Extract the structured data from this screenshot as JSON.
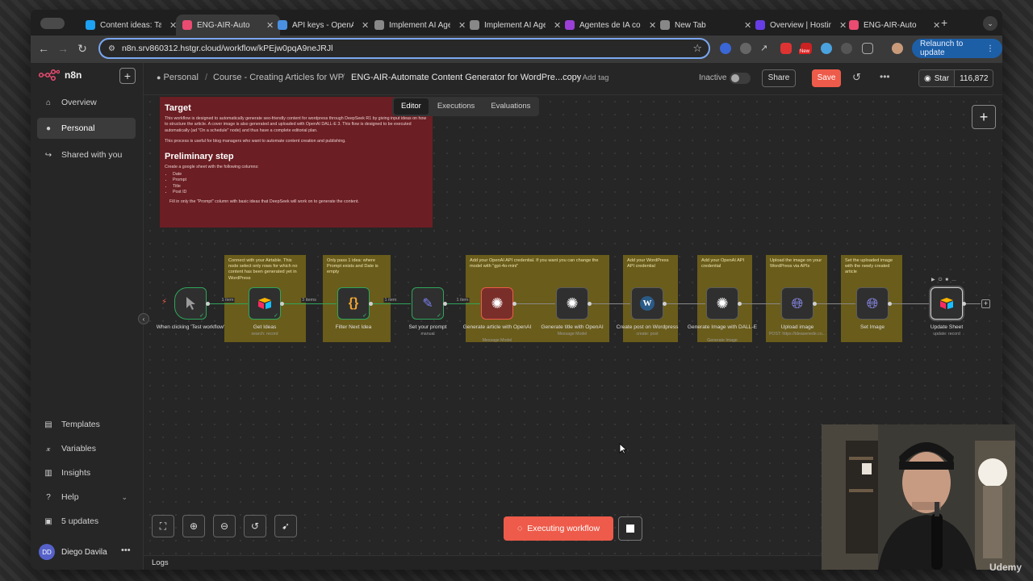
{
  "browser": {
    "tabs": [
      {
        "title": "Content ideas: Ta",
        "color": "#1da1f2"
      },
      {
        "title": "ENG-AIR-Auto",
        "color": "#ea4b71"
      },
      {
        "title": "API keys - OpenA",
        "color": "#4a90e2"
      },
      {
        "title": "Implement AI Age",
        "color": "#888888"
      },
      {
        "title": "Implement AI Age",
        "color": "#888888"
      },
      {
        "title": "Agentes de IA co",
        "color": "#9b3fd6"
      },
      {
        "title": "New Tab",
        "color": "#888888"
      },
      {
        "title": "Overview | Hostin",
        "color": "#673de6"
      },
      {
        "title": "ENG-AIR-Auto",
        "color": "#ea4b71"
      }
    ],
    "url": "n8n.srv860312.hstgr.cloud/workflow/kPEjw0pqA9neJRJl",
    "relaunch_label": "Relaunch to update",
    "ext_badge": "New"
  },
  "sidebar": {
    "brand": "n8n",
    "items": [
      {
        "label": "Overview",
        "icon": "home-icon"
      },
      {
        "label": "Personal",
        "icon": "user-icon"
      },
      {
        "label": "Shared with you",
        "icon": "share-icon"
      }
    ],
    "bottom_items": [
      {
        "label": "Templates",
        "icon": "templates-icon"
      },
      {
        "label": "Variables",
        "icon": "variables-icon"
      },
      {
        "label": "Insights",
        "icon": "insights-icon"
      },
      {
        "label": "Help",
        "icon": "help-icon"
      },
      {
        "label": "5 updates",
        "icon": "gift-icon"
      }
    ],
    "user": {
      "initials": "DD",
      "name": "Diego Davila"
    }
  },
  "header": {
    "crumb_personal": "Personal",
    "crumb_project": "Course - Creating Articles for WP",
    "crumb_sep": "/",
    "workflow_name": "ENG-AIR-Automate Content Generator for WordPre...copy",
    "add_tag": "+ Add tag",
    "status": "Inactive",
    "share": "Share",
    "save": "Save",
    "github_star": "Star",
    "github_count": "116,872",
    "tabs": [
      "Editor",
      "Executions",
      "Evaluations"
    ]
  },
  "sticky_target": {
    "title": "Target",
    "p1": "This workflow is designed to automatically generate seo-friendly content for wordpress through DeepSeek R1 by giving input ideas on how to structure the article. A cover image is also generated and uploaded with OpenAI DALL-E 3. This flow is designed to be executed automatically (ad \"On a schedule\" node) and thus have a complete editorial plan.",
    "p2": "This process is useful for blog managers who want to automate content creation and publishing.",
    "title2": "Preliminary step",
    "p3": "Create a google sheet with the following columns:",
    "columns": [
      "Date",
      "Prompt",
      "Title",
      "Post ID"
    ],
    "p4": "Fill in only the \"Prompt\" column with basic ideas that DeepSeek will work on to generate the content."
  },
  "notes": {
    "airtable": "Connect with your Airtable. This node select only rows for which no content has been generated yet in WordPress",
    "filter": "Only pass 1 idea: where Prompt exists and Date is empty",
    "openai": "Add your OpenAI API credential. If you want you can change the model with \"gpt-4o-mini\"",
    "wordpress": "Add your WordPress API credential",
    "openai2": "Add your OpenAI API credential",
    "upload": "Upload the image on your WordPress via APIs",
    "setimage": "Set the uploaded image with the newly created article"
  },
  "nodes": [
    {
      "label": "When clicking 'Test workflow'",
      "sub": "",
      "icon": "cursor-click-icon"
    },
    {
      "label": "Get Ideas",
      "sub": "search: record",
      "icon": "airtable-icon"
    },
    {
      "label": "Filter Next Idea",
      "sub": "",
      "icon": "code-braces-icon"
    },
    {
      "label": "Set your prompt",
      "sub": "manual",
      "icon": "pen-icon"
    },
    {
      "label": "Generate article with OpenAI",
      "sub": "Message Model",
      "icon": "openai-icon"
    },
    {
      "label": "Generate title with OpenAI",
      "sub": "Message Model",
      "icon": "openai-icon"
    },
    {
      "label": "Create post on Wordpress",
      "sub": "create: post",
      "icon": "wordpress-icon"
    },
    {
      "label": "Generate Image with DALL-E",
      "sub": "Generate Image",
      "icon": "openai-icon"
    },
    {
      "label": "Upload image",
      "sub": "POST: https://ideasenede.co...",
      "icon": "globe-icon"
    },
    {
      "label": "Set Image",
      "sub": "",
      "icon": "globe-icon"
    },
    {
      "label": "Update Sheet",
      "sub": "update: record",
      "icon": "airtable-icon"
    }
  ],
  "connections": [
    "1 item",
    "3 items",
    "1 item",
    "1 item"
  ],
  "canvas": {
    "execute_label": "Executing workflow",
    "logs_label": "Logs"
  },
  "overlay": {
    "watermark": "Udemy"
  }
}
